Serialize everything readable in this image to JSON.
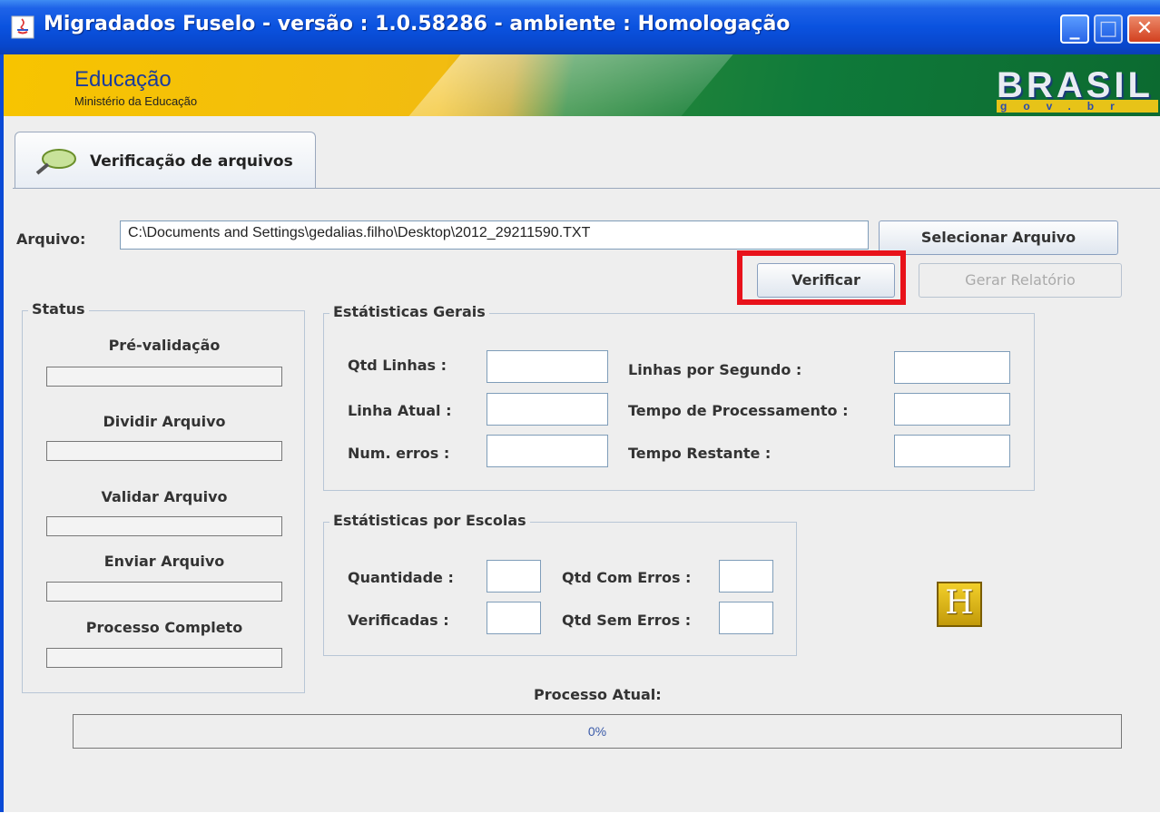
{
  "window": {
    "title": "Migradados Fuselo - versão : 1.0.58286 - ambiente : Homologação"
  },
  "banner": {
    "education": "Educação",
    "ministry": "Ministério da Educação",
    "brasil": "BRASIL",
    "gov": "gov.br"
  },
  "tab": {
    "label": "Verificação de arquivos"
  },
  "file": {
    "label": "Arquivo:",
    "value": "C:\\Documents and Settings\\gedalias.filho\\Desktop\\2012_29211590.TXT",
    "select_button": "Selecionar Arquivo",
    "verify_button": "Verificar",
    "report_button": "Gerar Relatório"
  },
  "status": {
    "title": "Status",
    "steps": [
      "Pré-validação",
      "Dividir Arquivo",
      "Validar Arquivo",
      "Enviar Arquivo",
      "Processo Completo"
    ]
  },
  "general_stats": {
    "title": "Estátisticas Gerais",
    "qtd_linhas": "Qtd Linhas :",
    "linha_atual": "Linha Atual :",
    "num_erros": "Num. erros :",
    "linhas_segundo": "Linhas por Segundo :",
    "tempo_processamento": "Tempo de Processamento :",
    "tempo_restante": "Tempo Restante :"
  },
  "school_stats": {
    "title": "Estátisticas por Escolas",
    "quantidade": "Quantidade :",
    "verificadas": "Verificadas :",
    "com_erros": "Qtd Com Erros :",
    "sem_erros": "Qtd Sem Erros :"
  },
  "logo_letter": "H",
  "current_process": {
    "label": "Processo Atual:",
    "percent": "0%",
    "progress": 0
  }
}
